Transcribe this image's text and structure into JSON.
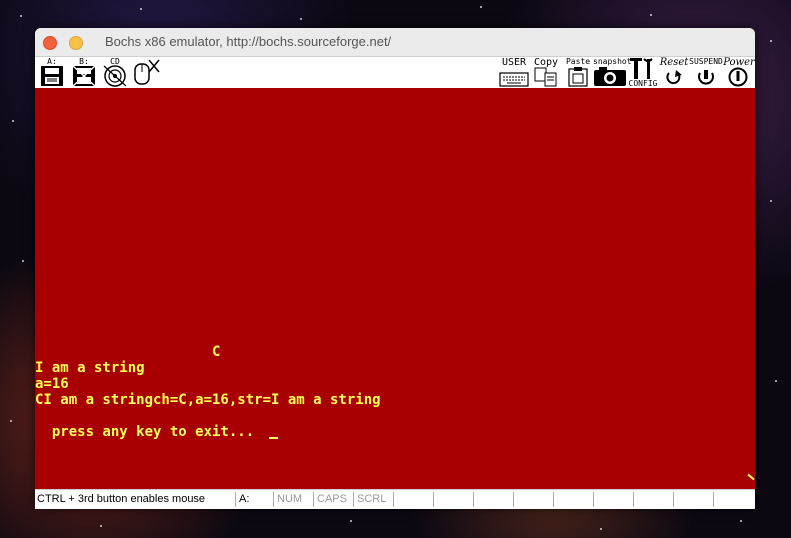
{
  "window": {
    "title": "Bochs x86 emulator, http://bochs.sourceforge.net/"
  },
  "toolbar": {
    "floppy_a_label": "A:",
    "floppy_b_label": "B:",
    "cdrom_label": "CD",
    "user_label": "USER",
    "copy_label": "Copy",
    "paste_label": "Paste",
    "snapshot_label": "snapshot",
    "config_label": "CONFIG",
    "reset_label": "Reset",
    "suspend_label": "SUSPEND",
    "power_label": "Power"
  },
  "screen": {
    "bg_color": "#a80000",
    "text_color": "#ffff55",
    "lines": [
      "                     C",
      "I am a string",
      "a=16",
      "CI am a stringch=C,a=16,str=I am a string",
      "",
      "  press any key to exit..."
    ]
  },
  "statusbar": {
    "message": "CTRL + 3rd button enables mouse",
    "drive": "A:",
    "num": "NUM",
    "caps": "CAPS",
    "scrl": "SCRL"
  }
}
